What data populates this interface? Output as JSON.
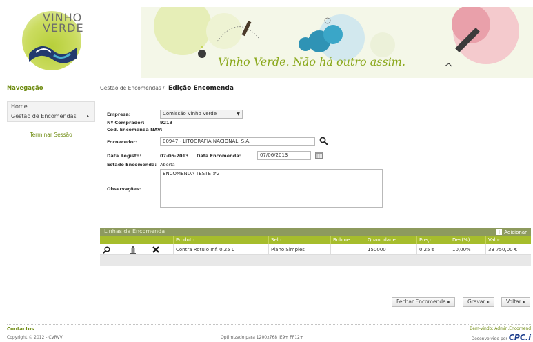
{
  "header": {
    "logo_line1": "VINHO",
    "logo_line2": "VERDE",
    "tagline": "Vinho Verde. Não há outro assim."
  },
  "nav": {
    "title": "Navegação",
    "items": [
      {
        "label": "Home"
      },
      {
        "label": "Gestão de Encomendas",
        "arrow": "▸"
      }
    ],
    "logout": "Terminar Sessão"
  },
  "breadcrumb": {
    "parent": "Gestão de Encomendas /",
    "current": "Edição Encomenda"
  },
  "form": {
    "empresa_label": "Empresa:",
    "empresa_value": "Comissão Vinho Verde",
    "comprador_label": "Nº Comprador:",
    "comprador_value": "9213",
    "cod_nav_label": "Cód. Encomenda NAV:",
    "fornecedor_label": "Fornecedor:",
    "fornecedor_value": "00947 - LITOGRAFIA NACIONAL, S.A.",
    "data_registo_label": "Data Registo:",
    "data_registo_value": "07-06-2013",
    "data_encomenda_label": "Data Encomenda:",
    "data_encomenda_value": "07/06/2013",
    "estado_label": "Estado Encomenda:",
    "estado_value": "Aberta",
    "observacoes_label": "Observações:",
    "observacoes_value": "ENCOMENDA TESTE #2"
  },
  "linhas": {
    "title": "Linhas da Encomenda",
    "add_label": "Adicionar",
    "columns": [
      "Produto",
      "Selo",
      "Bobine",
      "Quantidade",
      "Preço",
      "Des(%)",
      "Valor"
    ],
    "rows": [
      {
        "produto": "Contra Rotulo Inf. 0,25 L",
        "selo": "Plano Simples",
        "bobine": "",
        "quantidade": "150000",
        "preco": "0,25 €",
        "desconto": "10,00%",
        "valor": "33 750,00 €"
      }
    ]
  },
  "actions": {
    "fechar": "Fechar Encomenda",
    "gravar": "Gravar",
    "voltar": "Voltar",
    "arrow": "▸"
  },
  "footer": {
    "contactos": "Contactos",
    "welcome": "Bem-vindo: Admin.Encomend",
    "copyright": "Copyright © 2012 - CVRVV",
    "optimized": "Optimizado para 1200x768 IE9+ FF12+",
    "developed": "Desenvolvido por",
    "dev_brand": "CPC.i"
  }
}
